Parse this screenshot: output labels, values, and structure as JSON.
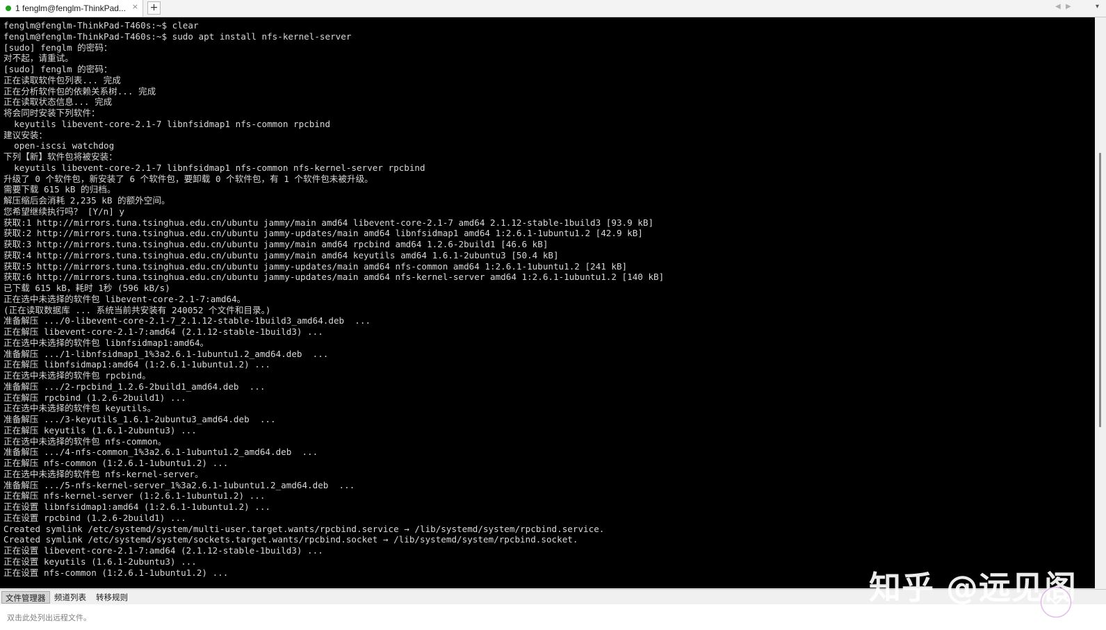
{
  "tab": {
    "label": "1 fenglm@fenglm-ThinkPad...",
    "close_glyph": "×",
    "add_glyph": "+",
    "nav_prev": "◀",
    "nav_next": "▶",
    "nav_menu": "▾",
    "status_color": "#1aa31a"
  },
  "terminal": {
    "lines": [
      "fenglm@fenglm-ThinkPad-T460s:~$ clear",
      "fenglm@fenglm-ThinkPad-T460s:~$ sudo apt install nfs-kernel-server",
      "[sudo] fenglm 的密码：",
      "对不起，请重试。",
      "[sudo] fenglm 的密码：",
      "正在读取软件包列表... 完成",
      "正在分析软件包的依赖关系树... 完成",
      "正在读取状态信息... 完成",
      "将会同时安装下列软件：",
      "  keyutils libevent-core-2.1-7 libnfsidmap1 nfs-common rpcbind",
      "建议安装：",
      "  open-iscsi watchdog",
      "下列【新】软件包将被安装：",
      "  keyutils libevent-core-2.1-7 libnfsidmap1 nfs-common nfs-kernel-server rpcbind",
      "升级了 0 个软件包，新安装了 6 个软件包，要卸载 0 个软件包，有 1 个软件包未被升级。",
      "需要下载 615 kB 的归档。",
      "解压缩后会消耗 2,235 kB 的额外空间。",
      "您希望继续执行吗？ [Y/n] y",
      "获取:1 http://mirrors.tuna.tsinghua.edu.cn/ubuntu jammy/main amd64 libevent-core-2.1-7 amd64 2.1.12-stable-1build3 [93.9 kB]",
      "获取:2 http://mirrors.tuna.tsinghua.edu.cn/ubuntu jammy-updates/main amd64 libnfsidmap1 amd64 1:2.6.1-1ubuntu1.2 [42.9 kB]",
      "获取:3 http://mirrors.tuna.tsinghua.edu.cn/ubuntu jammy/main amd64 rpcbind amd64 1.2.6-2build1 [46.6 kB]",
      "获取:4 http://mirrors.tuna.tsinghua.edu.cn/ubuntu jammy/main amd64 keyutils amd64 1.6.1-2ubuntu3 [50.4 kB]",
      "获取:5 http://mirrors.tuna.tsinghua.edu.cn/ubuntu jammy-updates/main amd64 nfs-common amd64 1:2.6.1-1ubuntu1.2 [241 kB]",
      "获取:6 http://mirrors.tuna.tsinghua.edu.cn/ubuntu jammy-updates/main amd64 nfs-kernel-server amd64 1:2.6.1-1ubuntu1.2 [140 kB]",
      "已下载 615 kB，耗时 1秒 (596 kB/s)",
      "正在选中未选择的软件包 libevent-core-2.1-7:amd64。",
      "(正在读取数据库 ... 系统当前共安装有 240052 个文件和目录。)",
      "准备解压 .../0-libevent-core-2.1-7_2.1.12-stable-1build3_amd64.deb  ...",
      "正在解压 libevent-core-2.1-7:amd64 (2.1.12-stable-1build3) ...",
      "正在选中未选择的软件包 libnfsidmap1:amd64。",
      "准备解压 .../1-libnfsidmap1_1%3a2.6.1-1ubuntu1.2_amd64.deb  ...",
      "正在解压 libnfsidmap1:amd64 (1:2.6.1-1ubuntu1.2) ...",
      "正在选中未选择的软件包 rpcbind。",
      "准备解压 .../2-rpcbind_1.2.6-2build1_amd64.deb  ...",
      "正在解压 rpcbind (1.2.6-2build1) ...",
      "正在选中未选择的软件包 keyutils。",
      "准备解压 .../3-keyutils_1.6.1-2ubuntu3_amd64.deb  ...",
      "正在解压 keyutils (1.6.1-2ubuntu3) ...",
      "正在选中未选择的软件包 nfs-common。",
      "准备解压 .../4-nfs-common_1%3a2.6.1-1ubuntu1.2_amd64.deb  ...",
      "正在解压 nfs-common (1:2.6.1-1ubuntu1.2) ...",
      "正在选中未选择的软件包 nfs-kernel-server。",
      "准备解压 .../5-nfs-kernel-server_1%3a2.6.1-1ubuntu1.2_amd64.deb  ...",
      "正在解压 nfs-kernel-server (1:2.6.1-1ubuntu1.2) ...",
      "正在设置 libnfsidmap1:amd64 (1:2.6.1-1ubuntu1.2) ...",
      "正在设置 rpcbind (1.2.6-2build1) ...",
      "Created symlink /etc/systemd/system/multi-user.target.wants/rpcbind.service → /lib/systemd/system/rpcbind.service.",
      "Created symlink /etc/systemd/system/sockets.target.wants/rpcbind.socket → /lib/systemd/system/rpcbind.socket.",
      "正在设置 libevent-core-2.1-7:amd64 (2.1.12-stable-1build3) ...",
      "正在设置 keyutils (1.6.1-2ubuntu3) ...",
      "正在设置 nfs-common (1:2.6.1-1ubuntu1.2) ..."
    ]
  },
  "panel": {
    "tabs": [
      "文件管理器",
      "频道列表",
      "转移规则"
    ],
    "active_tab": "文件管理器",
    "hint": "双击此处列出远程文件。"
  },
  "watermark": {
    "text": "知乎 @远见阁"
  }
}
